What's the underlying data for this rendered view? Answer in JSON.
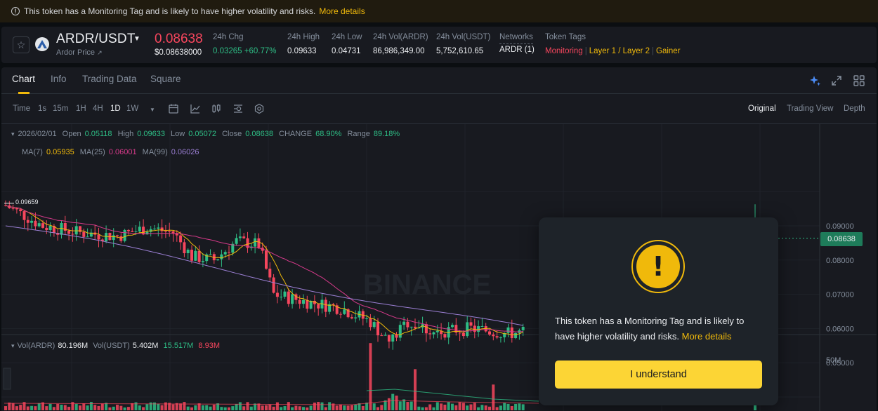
{
  "banner": {
    "text": "This token has a Monitoring Tag and is likely to have higher volatility and risks.",
    "link": "More details"
  },
  "ticker": {
    "pair": "ARDR/USDT",
    "subtitle": "Ardor Price",
    "subtitle_arrow": "↗",
    "last_price": "0.08638",
    "last_price_usd": "$0.08638000",
    "stats": [
      {
        "label": "24h Chg",
        "value": "0.03265 +60.77%"
      },
      {
        "label": "24h High",
        "value": "0.09633"
      },
      {
        "label": "24h Low",
        "value": "0.04731"
      },
      {
        "label": "24h Vol(ARDR)",
        "value": "86,986,349.00"
      },
      {
        "label": "24h Vol(USDT)",
        "value": "5,752,610.65"
      },
      {
        "label": "Networks",
        "value": "ARDR (1)"
      }
    ],
    "token_tags_label": "Token Tags",
    "tags": [
      {
        "text": "Monitoring",
        "color": "#f6465d"
      },
      {
        "text": "Layer 1 / Layer 2",
        "color": "#f0b90b"
      },
      {
        "text": "Gainer",
        "color": "#f0b90b"
      }
    ]
  },
  "tabs": [
    "Chart",
    "Info",
    "Trading Data",
    "Square"
  ],
  "active_tab": "Chart",
  "toolbar": {
    "intervals": [
      "Time",
      "1s",
      "15m",
      "1H",
      "4H",
      "1D",
      "1W"
    ],
    "active_interval": "1D",
    "views": [
      "Original",
      "Trading View",
      "Depth"
    ],
    "active_view": "Original"
  },
  "ohlc": {
    "date": "2026/02/01",
    "open_label": "Open",
    "open": "0.05118",
    "high_label": "High",
    "high": "0.09633",
    "low_label": "Low",
    "low": "0.05072",
    "close_label": "Close",
    "close": "0.08638",
    "change_label": "CHANGE",
    "change": "68.90%",
    "range_label": "Range",
    "range": "89.18%"
  },
  "ma": {
    "ma7_label": "MA(7)",
    "ma7": "0.05935",
    "ma25_label": "MA(25)",
    "ma25": "0.06001",
    "ma99_label": "MA(99)",
    "ma99": "0.06026"
  },
  "volume": {
    "vol_ardr_label": "Vol(ARDR)",
    "vol_ardr": "80.196M",
    "vol_usdt_label": "Vol(USDT)",
    "vol_usdt": "5.402M",
    "ma_a": "15.517M",
    "ma_b": "8.93M"
  },
  "watermark": "BINANCE",
  "chart_data": {
    "type": "candlestick",
    "price_axis_ticks": [
      "0.09000",
      "0.08000",
      "0.07000",
      "0.06000",
      "0.05000"
    ],
    "volume_axis_ticks": [
      "50M"
    ],
    "current_price_tag": "0.08638",
    "visible_high_marker": "0.09659",
    "colors": {
      "up": "#2ebd85",
      "down": "#f6465d",
      "ma7": "#f0b90b",
      "ma25": "#d63a8a",
      "ma99": "#9b7fd4"
    }
  },
  "modal": {
    "text": "This token has a Monitoring Tag and is likely to have higher volatility and risks.",
    "link": "More details",
    "button": "I understand"
  }
}
